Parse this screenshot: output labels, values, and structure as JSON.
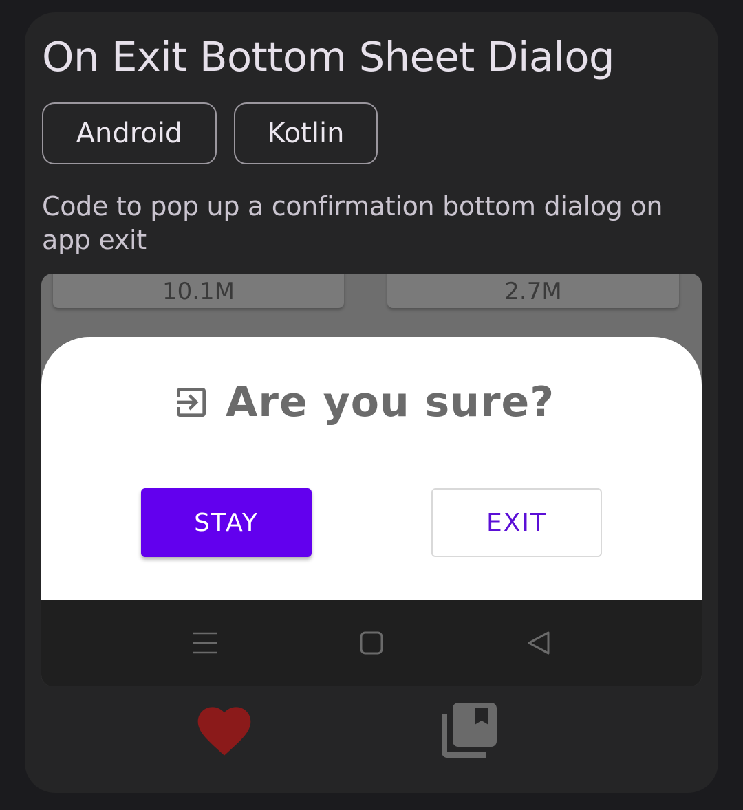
{
  "card": {
    "title": "On Exit Bottom Sheet Dialog",
    "tags": [
      "Android",
      "Kotlin"
    ],
    "description": "Code to pop up a confirmation bottom dialog on app exit"
  },
  "preview": {
    "stats": [
      "10.1M",
      "2.7M"
    ],
    "dialog": {
      "icon": "exit-to-app-icon",
      "title": "Are you sure?",
      "stay_label": "STAY",
      "exit_label": "EXIT"
    },
    "navbar": {
      "icons": [
        "menu-icon",
        "home-icon",
        "back-icon"
      ]
    }
  },
  "actions": {
    "like_icon": "heart-icon",
    "save_icon": "bookmark-collection-icon"
  },
  "colors": {
    "background": "#1b1b1e",
    "card": "#252526",
    "accent_purple": "#6200ee",
    "heart": "#8b1a1a"
  }
}
